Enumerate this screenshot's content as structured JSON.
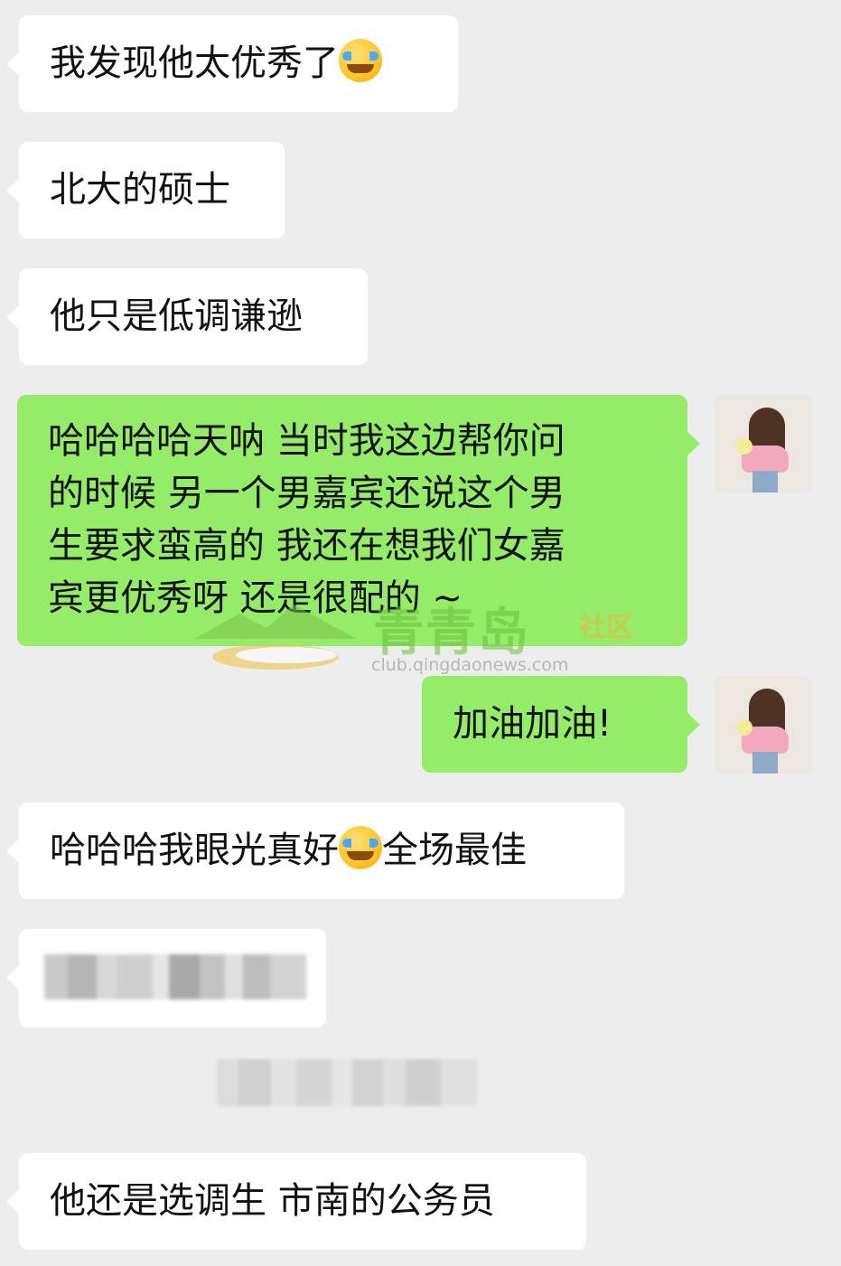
{
  "chat": {
    "messages": [
      {
        "side": "in",
        "text": "我发现他太优秀了",
        "emoji": "face-with-tears-of-joy"
      },
      {
        "side": "in",
        "text": "北大的硕士"
      },
      {
        "side": "in",
        "text": "他只是低调谦逊"
      },
      {
        "side": "out",
        "lines": [
          "哈哈哈哈天呐 当时我这边帮你问",
          "的时候 另一个男嘉宾还说这个男",
          "生要求蛮高的 我还在想我们女嘉",
          "宾更优秀呀 还是很配的 ~"
        ]
      },
      {
        "side": "out",
        "text": "加油加油!"
      },
      {
        "side": "in",
        "text_before": "哈哈哈我眼光真好",
        "emoji": "face-with-tears-of-joy",
        "text_after": "全场最佳"
      },
      {
        "side": "in",
        "redacted": true
      },
      {
        "side": "system",
        "redacted": true
      },
      {
        "side": "in",
        "text": "他还是选调生 市南的公务员"
      }
    ]
  },
  "watermark": {
    "brand": "青青岛",
    "suffix": "社区",
    "url": "club.qingdaonews.com"
  },
  "colors": {
    "background": "#ededed",
    "incoming_bubble": "#ffffff",
    "outgoing_bubble": "#95ec69",
    "text": "#111111"
  }
}
